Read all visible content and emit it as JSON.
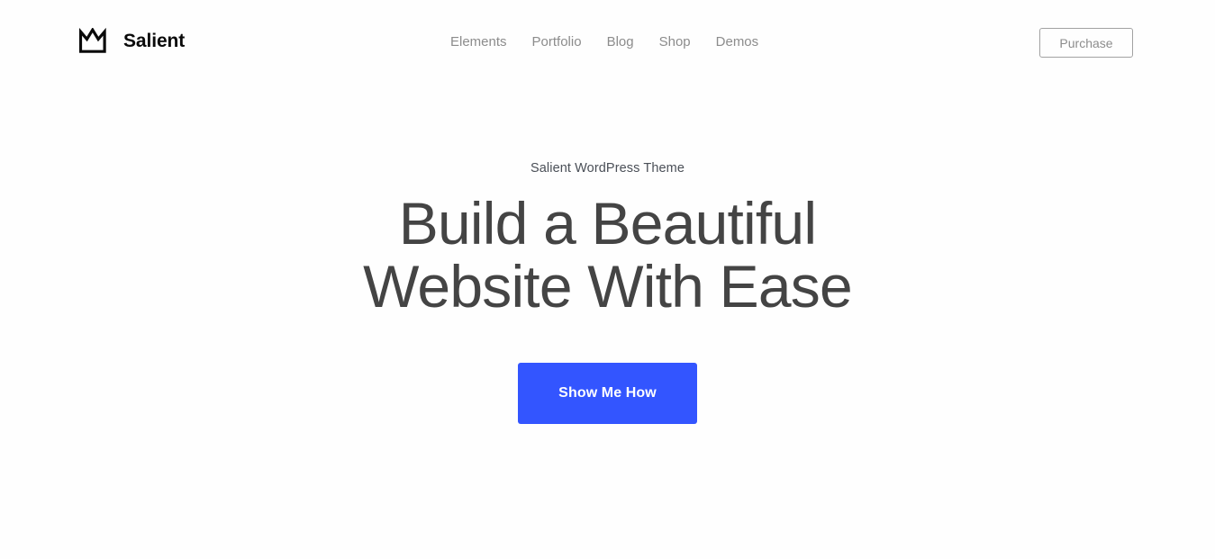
{
  "brand": {
    "name": "Salient",
    "logo_icon": "crown-icon"
  },
  "nav": {
    "items": [
      {
        "label": "Elements"
      },
      {
        "label": "Portfolio"
      },
      {
        "label": "Blog"
      },
      {
        "label": "Shop"
      },
      {
        "label": "Demos"
      }
    ]
  },
  "header": {
    "purchase_label": "Purchase"
  },
  "hero": {
    "eyebrow": "Salient WordPress Theme",
    "title_line_1": "Build a Beautiful",
    "title_line_2": "Website With Ease",
    "cta_label": "Show Me How"
  },
  "colors": {
    "accent": "#3355ff",
    "heading": "#444444",
    "nav_text": "#8c8c8c",
    "eyebrow_text": "#4a4f57",
    "border": "#a2a2a2",
    "background": "#fefefe",
    "brand_text": "#0a0a0a"
  }
}
